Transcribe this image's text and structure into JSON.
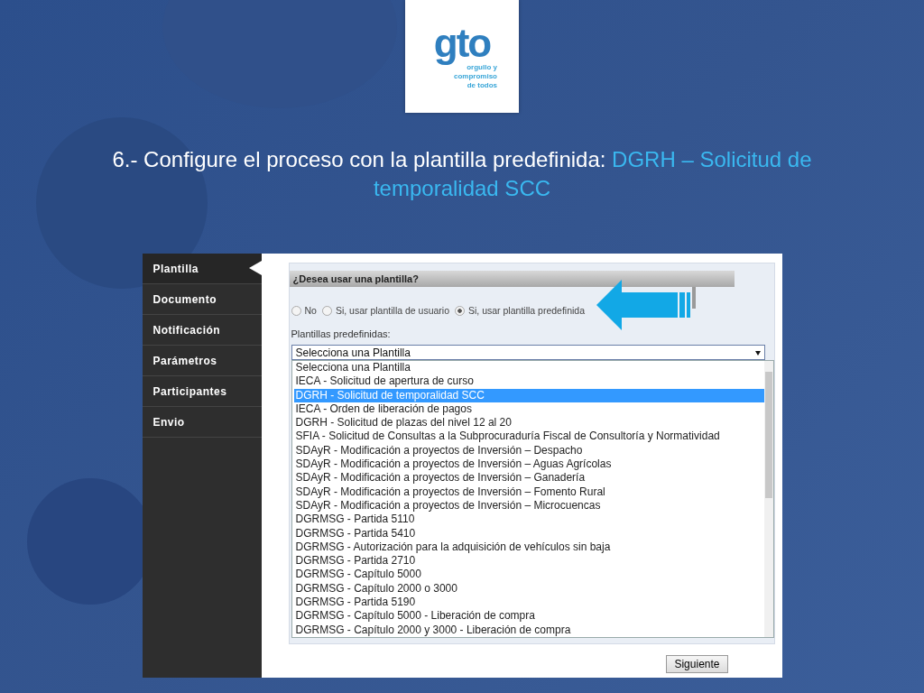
{
  "logo": {
    "wordmark": "gto",
    "tagline": [
      "orgullo y",
      "compromiso",
      "de todos"
    ]
  },
  "title": {
    "text": "6.- Configure el proceso con la plantilla predefinida: ",
    "highlight": "DGRH – Solicitud de temporalidad SCC"
  },
  "sidebar": {
    "items": [
      {
        "label": "Plantilla",
        "selected": true
      },
      {
        "label": "Documento",
        "selected": false
      },
      {
        "label": "Notificación",
        "selected": false
      },
      {
        "label": "Parámetros",
        "selected": false
      },
      {
        "label": "Participantes",
        "selected": false
      },
      {
        "label": "Envio",
        "selected": false
      }
    ]
  },
  "form": {
    "question": "¿Desea usar una plantilla?",
    "radios": [
      {
        "label": "No",
        "selected": false
      },
      {
        "label": "Si, usar plantilla de usuario",
        "selected": false
      },
      {
        "label": "Si, usar plantilla predefinida",
        "selected": true
      }
    ],
    "select_label": "Plantillas predefinidas:",
    "select_value": "Selecciona una Plantilla",
    "options": [
      {
        "label": "Selecciona una Plantilla",
        "selected": false
      },
      {
        "label": "IECA - Solicitud de apertura de curso",
        "selected": false
      },
      {
        "label": "DGRH - Solicitud de temporalidad SCC",
        "selected": true
      },
      {
        "label": "IECA - Orden de liberación de pagos",
        "selected": false
      },
      {
        "label": "DGRH - Solicitud de plazas del nivel 12 al 20",
        "selected": false
      },
      {
        "label": "SFIA - Solicitud de Consultas a la Subprocuraduría Fiscal de Consultoría y Normatividad",
        "selected": false
      },
      {
        "label": "SDAyR - Modificación a proyectos de Inversión – Despacho",
        "selected": false
      },
      {
        "label": "SDAyR - Modificación a proyectos de Inversión – Aguas Agrícolas",
        "selected": false
      },
      {
        "label": "SDAyR - Modificación a proyectos de Inversión – Ganadería",
        "selected": false
      },
      {
        "label": "SDAyR - Modificación a proyectos de Inversión – Fomento Rural",
        "selected": false
      },
      {
        "label": "SDAyR - Modificación a proyectos de Inversión – Microcuencas",
        "selected": false
      },
      {
        "label": "DGRMSG - Partida 5110",
        "selected": false
      },
      {
        "label": "DGRMSG - Partida 5410",
        "selected": false
      },
      {
        "label": "DGRMSG - Autorización para la adquisición de vehículos sin baja",
        "selected": false
      },
      {
        "label": "DGRMSG - Partida 2710",
        "selected": false
      },
      {
        "label": "DGRMSG - Capítulo 5000",
        "selected": false
      },
      {
        "label": "DGRMSG - Capítulo 2000 o 3000",
        "selected": false
      },
      {
        "label": "DGRMSG - Partida 5190",
        "selected": false
      },
      {
        "label": "DGRMSG - Capítulo 5000 - Liberación de compra",
        "selected": false
      },
      {
        "label": "DGRMSG - Capítulo 2000 y 3000 - Liberación de compra",
        "selected": false
      }
    ],
    "next_button": "Siguiente"
  }
}
